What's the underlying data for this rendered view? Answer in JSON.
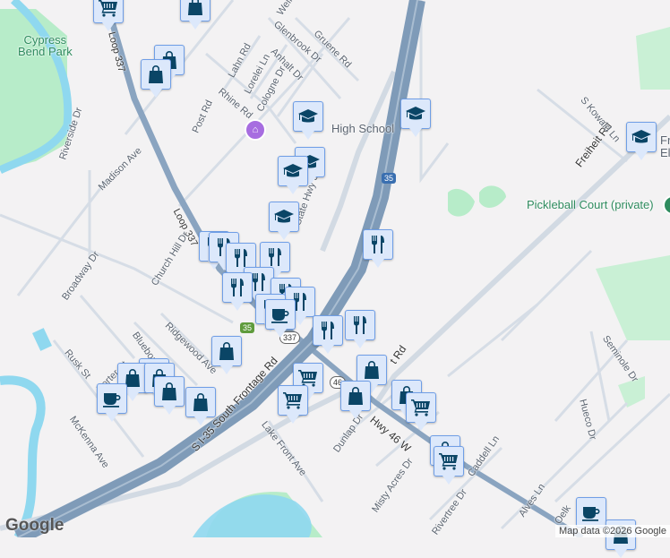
{
  "map": {
    "labels": {
      "park": "Cypress\nBend Park",
      "loop337a": "Loop 337",
      "loop337b": "Loop 337",
      "riverside": "Riverside Dr",
      "madison": "Madison Ave",
      "post": "Post Rd",
      "rhine": "Rhine Rd",
      "lahn": "Lahn Rd",
      "lorelei": "Lorelei Ln",
      "cologne": "Cologne Dr",
      "anhalt": "Anhalt Dr",
      "glenbrook": "Glenbrook Dr",
      "gruene": "Gruene Rd",
      "weil": "Weil",
      "high_school": "High School",
      "state_hwy": "State Hwy 3",
      "church_hill": "Church Hill Dr",
      "broadway": "Broadway Dr",
      "ridgewood": "Ridgewood Ave",
      "bluebonnet": "Bluebonnet",
      "rusk": "Rusk St",
      "porter": "Porter St",
      "mckenna": "McKenna Ave",
      "frontage": "S I-35 South Frontage Rd",
      "lake_front": "Lake Front Ave",
      "dunlap": "Dunlap Dr",
      "hwy46": "Hwy 46 W",
      "misty": "Misty Acres Dr",
      "rivertree": "Rivertree Dr",
      "caddell": "Caddell Ln",
      "alves": "Alves Ln",
      "hueco": "Hueco Dr",
      "seminole": "Seminole Dr",
      "freiheit": "Freiheit Rd",
      "kowald": "S Kowald Ln",
      "pickleball": "Pickleball Court (private)",
      "fr": "Fr\nEl",
      "st_rd": "t Rd",
      "oelk": "Oelk"
    },
    "shields": {
      "i35a": "35",
      "i35b": "35",
      "r46": "46",
      "r337": "337"
    },
    "markers": {
      "shopping": "shopping-bag",
      "grocery": "shopping-cart",
      "school": "graduation-cap",
      "restaurant": "fork-knife",
      "cafe": "coffee-cup"
    },
    "colors": {
      "marker_bg": "#dce8fb",
      "marker_border": "#6f9ee6",
      "marker_icon": "#0a4566",
      "highway": "#8aa4c0",
      "water": "#8fd8ef",
      "park": "#b7ecc9"
    },
    "logo": "Google",
    "attribution": "Map data ©2026 Google"
  }
}
